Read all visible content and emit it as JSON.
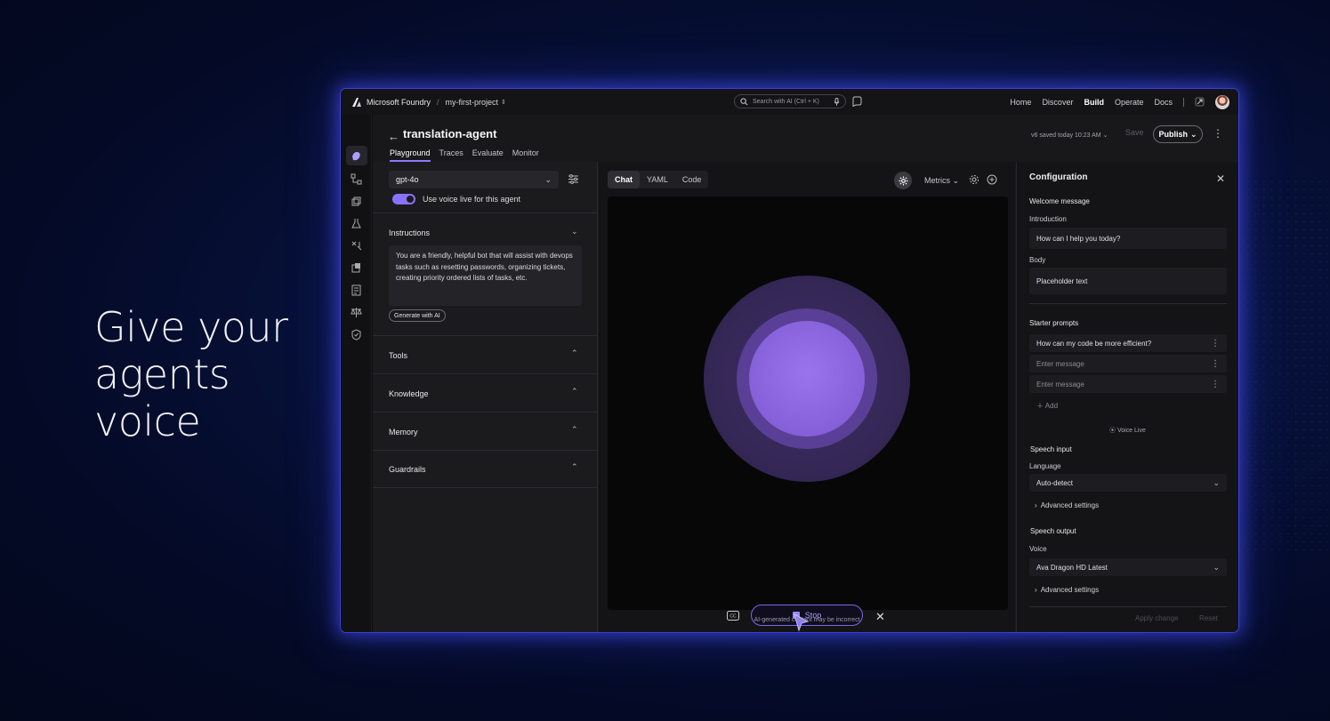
{
  "hero": {
    "line1": "Give your",
    "line2": "agents voice"
  },
  "topbar": {
    "brand": "Microsoft Foundry",
    "separator": "/",
    "project": "my-first-project",
    "search_placeholder": "Search with AI (Ctrl + K)",
    "nav": [
      "Home",
      "Discover",
      "Build",
      "Operate",
      "Docs"
    ],
    "active_nav": "Build"
  },
  "agent": {
    "title": "translation-agent",
    "tabs": [
      "Playground",
      "Traces",
      "Evaluate",
      "Monitor"
    ],
    "active_tab": "Playground",
    "saved_status": "v6 saved today 10:23 AM",
    "save_label": "Save",
    "publish_label": "Publish"
  },
  "left_panel": {
    "model": "gpt-4o",
    "voice_toggle_label": "Use voice live for this agent",
    "voice_toggle_on": true,
    "instructions_title": "Instructions",
    "instructions_text": "You are a friendly, helpful bot that will assist with devops tasks such as resetting passwords, organizing tickets, creating priority ordered lists of tasks, etc.",
    "generate_label": "Generate with AI",
    "sections": [
      "Tools",
      "Knowledge",
      "Memory",
      "Guardrails"
    ]
  },
  "center": {
    "tabs": [
      "Chat",
      "YAML",
      "Code"
    ],
    "active_tab": "Chat",
    "metrics_label": "Metrics",
    "stop_label": "Stop",
    "disclaimer": "AI-generated content may be incorrect",
    "orb_colors": {
      "outer": "#3e2f63",
      "mid": "#5a3f96",
      "inner": "#8660d8"
    }
  },
  "right_panel": {
    "title": "Configuration",
    "welcome_title": "Welcome message",
    "introduction_label": "Introduction",
    "introduction_value": "How can I help you today?",
    "body_label": "Body",
    "body_value": "Placeholder text",
    "starter_title": "Starter prompts",
    "starter_prompts": [
      "How can my code be more efficient?",
      "Enter message",
      "Enter message"
    ],
    "add_label": "Add",
    "voice_live_label": "Voice Live",
    "speech_input_title": "Speech input",
    "language_label": "Language",
    "language_value": "Auto-detect",
    "advanced_label": "Advanced settings",
    "speech_output_title": "Speech output",
    "voice_label": "Voice",
    "voice_value": "Ava Dragon HD Latest",
    "apply_label": "Apply change",
    "reset_label": "Reset"
  },
  "colors": {
    "accent": "#8c78ff",
    "window_glow": "#3a3fd9",
    "background": "#07123d"
  }
}
